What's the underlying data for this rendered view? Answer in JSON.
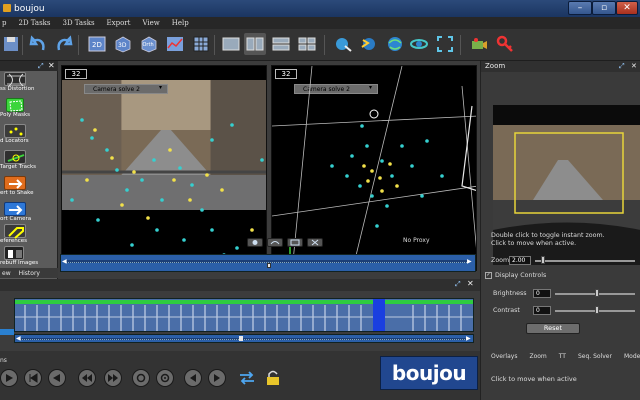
{
  "window": {
    "title": "boujou"
  },
  "menu": {
    "items": [
      "p",
      "2D Tasks",
      "3D Tasks",
      "Export",
      "View",
      "Help"
    ]
  },
  "left_panel": {
    "items": [
      {
        "label": "ss Distortion"
      },
      {
        "label": "Poly Masks"
      },
      {
        "label": "d Locators"
      },
      {
        "label": "Target Tracks"
      },
      {
        "label": "ert to Shake"
      },
      {
        "label": "ort Camera"
      },
      {
        "label": "eferences"
      },
      {
        "label": "rebuff Images"
      }
    ],
    "tabs": [
      "ew",
      "History"
    ]
  },
  "viewports": {
    "left": {
      "frame": "32",
      "camera": "Camera solve 2"
    },
    "right": {
      "frame": "32",
      "camera": "Camera solve 2"
    },
    "proxy": "No Proxy"
  },
  "zoom": {
    "title": "Zoom",
    "hint1": "Double click to toggle instant zoom.",
    "hint2": "Click to move when active.",
    "zoom_label": "Zoom",
    "zoom_value": "2.00",
    "display_controls": "Display Controls",
    "brightness_label": "Brightness",
    "brightness_value": "0",
    "contrast_label": "Contrast",
    "contrast_value": "0",
    "reset_label": "Reset",
    "tabs": [
      "Overlays",
      "Zoom",
      "TT",
      "Seq. Solver",
      "Mode"
    ],
    "status": "Click to move when active"
  },
  "timeline": {
    "label": "ns"
  },
  "logo": {
    "text": "boujou"
  },
  "colors": {
    "accent": "#2b5fa8",
    "track_yellow": "#f2e14a",
    "track_cyan": "#35d0d0",
    "green": "#2ecc40"
  }
}
